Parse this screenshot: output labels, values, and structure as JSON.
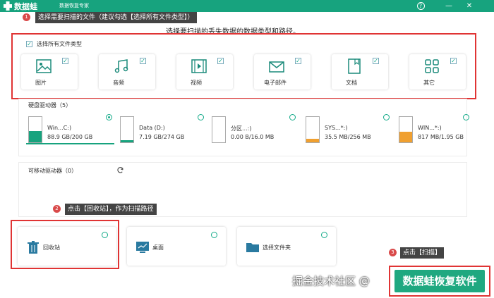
{
  "app": {
    "brand": "数据蛙",
    "subtitle": "数据恢复专家"
  },
  "window_controls": {
    "help": "?",
    "minimize": "—",
    "close": "✕"
  },
  "annotations": {
    "step1_num": "1",
    "step1_text": "选择需要扫描的文件（建议勾选【选择所有文件类型】）",
    "step2_num": "2",
    "step2_text": "点击【回收站】，作为扫描路径",
    "step3_num": "3",
    "step3_text": "点击【扫描】"
  },
  "prompt": "选择要扫描的丢失数据的数据类型和路径。",
  "file_types": {
    "select_all_label": "选择所有文件类型",
    "select_all_checked": true,
    "items": [
      {
        "label": "图片",
        "icon": "image-icon",
        "checked": true
      },
      {
        "label": "音频",
        "icon": "music-icon",
        "checked": true
      },
      {
        "label": "视频",
        "icon": "video-icon",
        "checked": true
      },
      {
        "label": "电子邮件",
        "icon": "email-icon",
        "checked": true
      },
      {
        "label": "文档",
        "icon": "document-icon",
        "checked": true
      },
      {
        "label": "其它",
        "icon": "other-icon",
        "checked": true
      }
    ]
  },
  "hard_drives": {
    "title": "硬盘驱动器（5）",
    "items": [
      {
        "name": "Win...C:)",
        "size": "88.9 GB/200 GB",
        "used_fraction": 0.44,
        "fill_color": "#17a37e",
        "selected": true
      },
      {
        "name": "Data (D:)",
        "size": "7.19 GB/274 GB",
        "used_fraction": 0.03,
        "fill_color": "#17a37e",
        "selected": false
      },
      {
        "name": "分区...:)",
        "size": "0.00  B/16.0 MB",
        "used_fraction": 0.0,
        "fill_color": "#17a37e",
        "selected": false
      },
      {
        "name": "SYS...*:)",
        "size": "35.5 MB/256 MB",
        "used_fraction": 0.14,
        "fill_color": "#f0a030",
        "selected": false
      },
      {
        "name": "WIN...*:)",
        "size": "817 MB/1.95 GB",
        "used_fraction": 0.42,
        "fill_color": "#f0a030",
        "selected": false
      }
    ]
  },
  "removable": {
    "title": "可移动驱动器（0）",
    "refresh_icon": "refresh-icon"
  },
  "locations": [
    {
      "label": "回收站",
      "icon": "recycle-bin-icon"
    },
    {
      "label": "桌面",
      "icon": "desktop-icon"
    },
    {
      "label": "选择文件夹",
      "icon": "folder-icon"
    }
  ],
  "scan_button": "数据蛙恢复软件",
  "watermark": "掘金技术社区 @"
}
